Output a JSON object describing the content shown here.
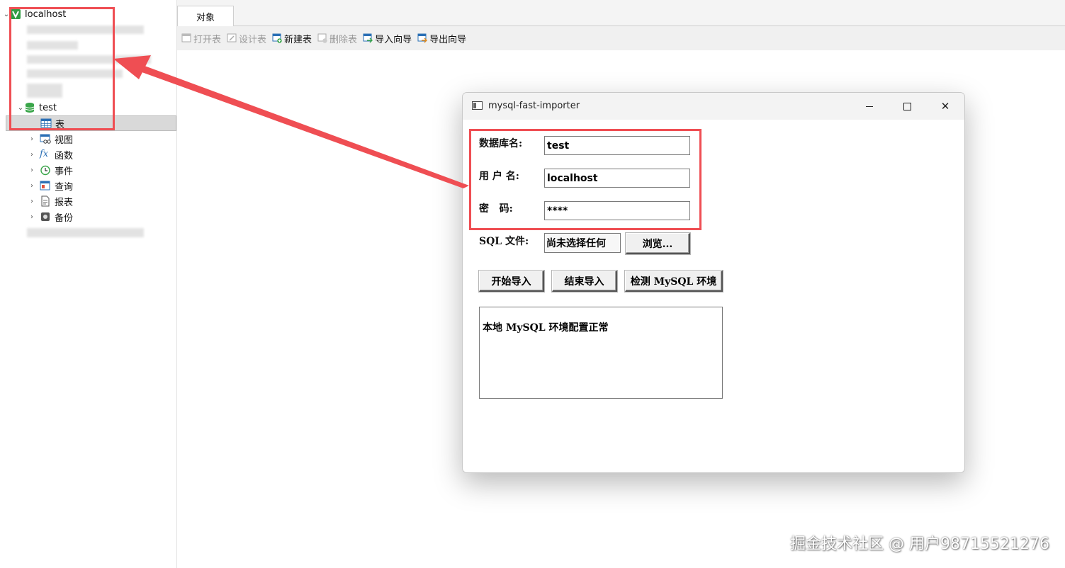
{
  "sidebar": {
    "connection": "localhost",
    "database": "test",
    "items": [
      {
        "label": "表"
      },
      {
        "label": "视图"
      },
      {
        "label": "函数"
      },
      {
        "label": "事件"
      },
      {
        "label": "查询"
      },
      {
        "label": "报表"
      },
      {
        "label": "备份"
      }
    ]
  },
  "tabs": {
    "objects": "对象"
  },
  "toolbar": {
    "open_table": "打开表",
    "design_table": "设计表",
    "new_table": "新建表",
    "delete_table": "删除表",
    "import_wizard": "导入向导",
    "export_wizard": "导出向导"
  },
  "dialog": {
    "title": "mysql-fast-importer",
    "db_label": "数据库名:",
    "db_value": "test",
    "user_label": "用 户 名:",
    "user_value": "localhost",
    "pwd_label": "密   码:",
    "pwd_value": "****",
    "sql_label": "SQL 文件:",
    "sql_file": "尚未选择任何",
    "browse": "浏览...",
    "start": "开始导入",
    "stop": "结束导入",
    "check": "检测 MySQL 环境",
    "log": "本地 MySQL 环境配置正常"
  },
  "watermark": "掘金技术社区 @ 用户98715521276",
  "colors": {
    "annotation": "#ef4e53",
    "db_icon": "#3aa64a"
  }
}
